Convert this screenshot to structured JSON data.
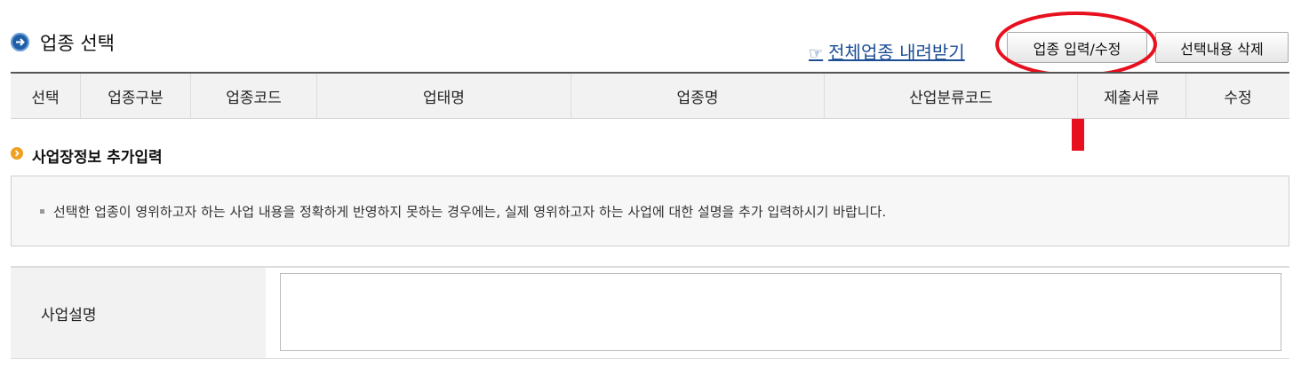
{
  "section": {
    "title": "업종 선택"
  },
  "toolbar": {
    "download_hand": "☞",
    "download_label": "전체업종 내려받기",
    "edit_label": "업종 입력/수정",
    "delete_label": "선택내용 삭제"
  },
  "table": {
    "headers": [
      "선택",
      "업종구분",
      "업종코드",
      "업태명",
      "업종명",
      "산업분류코드",
      "제출서류",
      "수정"
    ]
  },
  "extra": {
    "title": "사업장정보 추가입력",
    "notice": "선택한 업종이 영위하고자 하는 사업 내용을 정확하게 반영하지 못하는 경우에는, 실제 영위하고자 하는 사업에 대한 설명을 추가 입력하시기 바랍니다."
  },
  "description": {
    "label": "사업설명",
    "value": ""
  },
  "colors": {
    "annotation": "#e8101e",
    "link": "#1c4e94",
    "section_icon": "#1f5fa8",
    "sub_icon": "#f0a020"
  }
}
